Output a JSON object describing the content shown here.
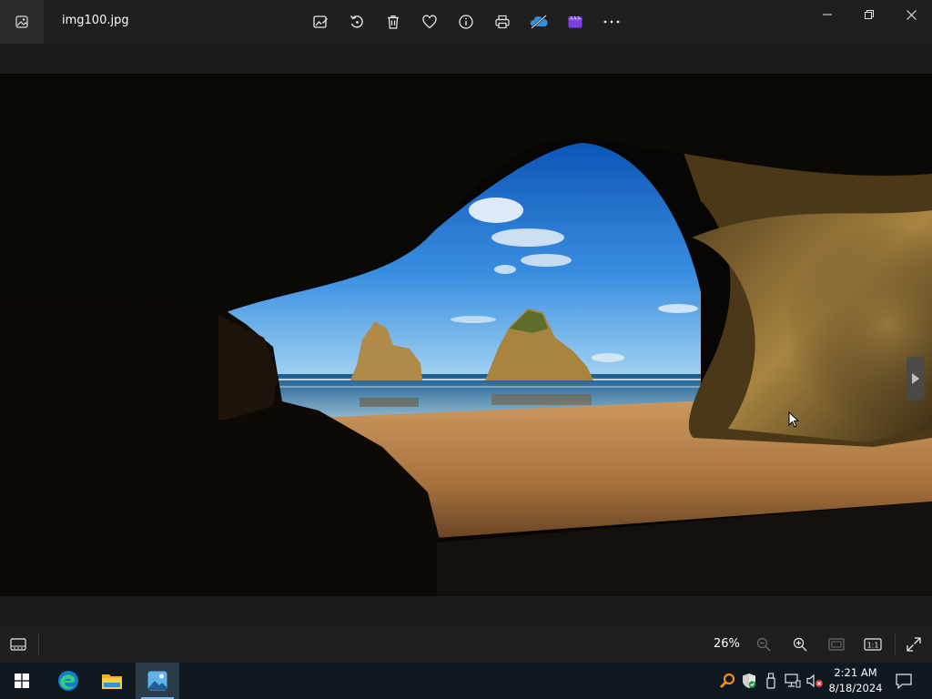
{
  "window": {
    "filename": "img100.jpg",
    "toolbar": [
      {
        "name": "edit-image-button",
        "icon": "edit-image-icon"
      },
      {
        "name": "rotate-button",
        "icon": "rotate-icon"
      },
      {
        "name": "delete-button",
        "icon": "trash-icon"
      },
      {
        "name": "favorite-button",
        "icon": "heart-icon"
      },
      {
        "name": "file-info-button",
        "icon": "info-icon"
      },
      {
        "name": "print-button",
        "icon": "printer-icon"
      },
      {
        "name": "onedrive-button",
        "icon": "onedrive-cloud-icon"
      },
      {
        "name": "clipchamp-button",
        "icon": "clipchamp-icon"
      },
      {
        "name": "more-button",
        "icon": "more-dots-icon"
      }
    ],
    "controls": [
      "minimize",
      "maximize",
      "close"
    ]
  },
  "viewer": {
    "image_alt": "Sea cave arch looking out at beach and rock formations (Wharariki Beach)"
  },
  "bottom_bar": {
    "zoom_level": "26%",
    "actual_size_label": "1:1"
  },
  "taskbar": {
    "apps": [
      "start",
      "edge",
      "file-explorer",
      "photos"
    ],
    "clock": {
      "time": "2:21 AM",
      "date": "8/18/2024"
    }
  },
  "colors": {
    "accent": "#76b9ed",
    "titlebar": "#1f1f1f",
    "taskbar": "#101820",
    "clipchamp": "#7b3fe4",
    "onedrive": "#2f8fdc",
    "defender": "#1c9c4a"
  }
}
